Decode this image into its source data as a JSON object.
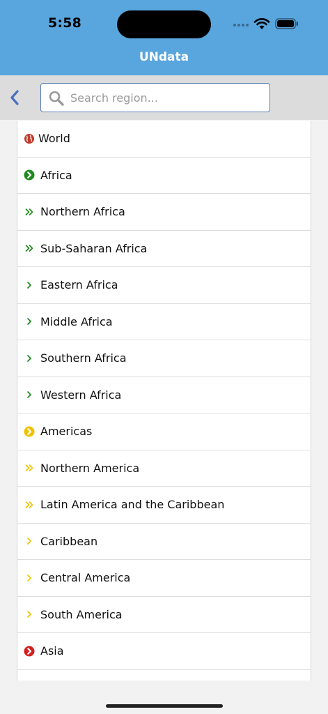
{
  "status_bar": {
    "time": "5:58"
  },
  "header": {
    "title": "UNdata"
  },
  "search": {
    "placeholder": "Search region..."
  },
  "colors": {
    "header_bg": "#59a5dd",
    "africa": "#1f8a1f",
    "americas": "#f2c200",
    "asia": "#d41f1f",
    "world": "#c0392b"
  },
  "regions": [
    {
      "label": "World",
      "icon": "globe-icon",
      "level": 0,
      "color": "#c0392b"
    },
    {
      "label": "Africa",
      "icon": "circle-chevron-icon",
      "level": 1,
      "color": "#1f8a1f"
    },
    {
      "label": "Northern Africa",
      "icon": "double-chevron-icon",
      "level": 2,
      "color": "#1f8a1f"
    },
    {
      "label": "Sub-Saharan Africa",
      "icon": "double-chevron-icon",
      "level": 2,
      "color": "#1f8a1f"
    },
    {
      "label": "Eastern Africa",
      "icon": "chevron-right-icon",
      "level": 3,
      "color": "#1f8a1f"
    },
    {
      "label": "Middle Africa",
      "icon": "chevron-right-icon",
      "level": 3,
      "color": "#1f8a1f"
    },
    {
      "label": "Southern Africa",
      "icon": "chevron-right-icon",
      "level": 3,
      "color": "#1f8a1f"
    },
    {
      "label": "Western Africa",
      "icon": "chevron-right-icon",
      "level": 3,
      "color": "#1f8a1f"
    },
    {
      "label": "Americas",
      "icon": "circle-chevron-icon",
      "level": 1,
      "color": "#f2c200"
    },
    {
      "label": "Northern America",
      "icon": "double-chevron-icon",
      "level": 2,
      "color": "#f2c200"
    },
    {
      "label": "Latin America and the Caribbean",
      "icon": "double-chevron-icon",
      "level": 2,
      "color": "#f2c200"
    },
    {
      "label": "Caribbean",
      "icon": "chevron-right-icon",
      "level": 3,
      "color": "#f2c200"
    },
    {
      "label": "Central America",
      "icon": "chevron-right-icon",
      "level": 3,
      "color": "#f2c200"
    },
    {
      "label": "South America",
      "icon": "chevron-right-icon",
      "level": 3,
      "color": "#f2c200"
    },
    {
      "label": "Asia",
      "icon": "circle-chevron-icon",
      "level": 1,
      "color": "#d41f1f"
    }
  ]
}
